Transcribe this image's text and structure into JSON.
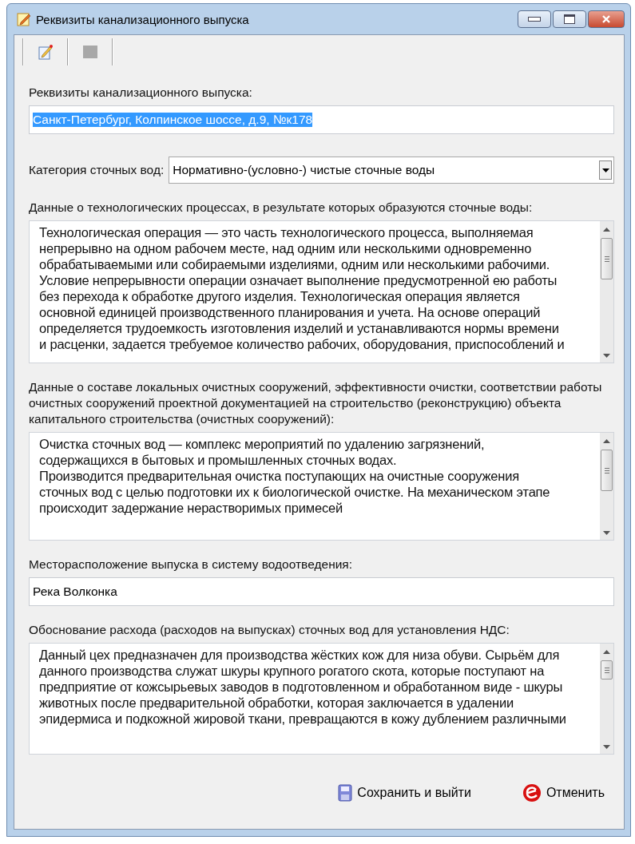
{
  "window": {
    "title": "Реквизиты канализационного выпуска"
  },
  "fields": [
    {
      "kind": "text",
      "label": "Реквизиты канализационного выпуска:",
      "value": "Санкт-Петербург, Колпинское шоссе, д.9, №к178",
      "highlighted": true
    },
    {
      "kind": "combo",
      "label": "Категория сточных вод:",
      "value": "Нормативно-(условно-) чистые сточные воды"
    },
    {
      "kind": "memo",
      "label": "Данные о технологических процессах, в результате которых образуются сточные воды:",
      "lines": [
        "Технологическая операция — это часть технологического процесса, выполняемая",
        "непрерывно на одном рабочем месте, над одним или несколькими одновременно",
        "обрабатываемыми или собираемыми изделиями, одним или несколькими рабочими.",
        "Условие непрерывности операции означает выполнение предусмотренной ею работы",
        "без перехода к обработке другого изделия. Технологическая операция является",
        "основной единицей производственного планирования и учета. На основе операций",
        "определяется трудоемкость изготовления изделий и устанавливаются нормы времени",
        "и расценки, задается требуемое количество рабочих, оборудования, приспособлений и"
      ]
    },
    {
      "kind": "memo",
      "label": "Данные о составе локальных очистных сооружений, эффективности очистки, соответствии работы очистных сооружений проектной документацией на строительство (реконструкцию) объекта капитального строительства (очистных сооружений):",
      "lines": [
        "Очистка сточных вод — комплекс мероприятий по удалению загрязнений,",
        "содержащихся в бытовых и промышленных сточных водах.",
        "Производится предварительная очистка поступающих на очистные сооружения",
        "сточных вод с целью подготовки их к биологической очистке. На механическом этапе",
        "происходит задержание нерастворимых примесей"
      ]
    },
    {
      "kind": "text",
      "label": "Месторасположение выпуска в систему водоотведения:",
      "value": "Река Волконка",
      "highlighted": false
    },
    {
      "kind": "memo",
      "label": "Обоснование расхода (расходов на выпусках) сточных вод для установления НДС:",
      "lines": [
        "Данный цех предназначен для производства жёстких кож для низа обуви. Сырьём для",
        "данного производства служат шкуры крупного рогатого скота, которые поступают на",
        "предприятие от кожсырьевых заводов в подготовленном и обработанном виде - шкуры",
        "животных после предварительной обработки, которая заключается в удалении",
        "эпидермиса и подкожной жировой ткани, превращаются в кожу дублением различными"
      ]
    }
  ],
  "buttons": [
    {
      "kind": "save",
      "label": "Сохранить и выйти"
    },
    {
      "kind": "cancel",
      "label": "Отменить"
    }
  ]
}
